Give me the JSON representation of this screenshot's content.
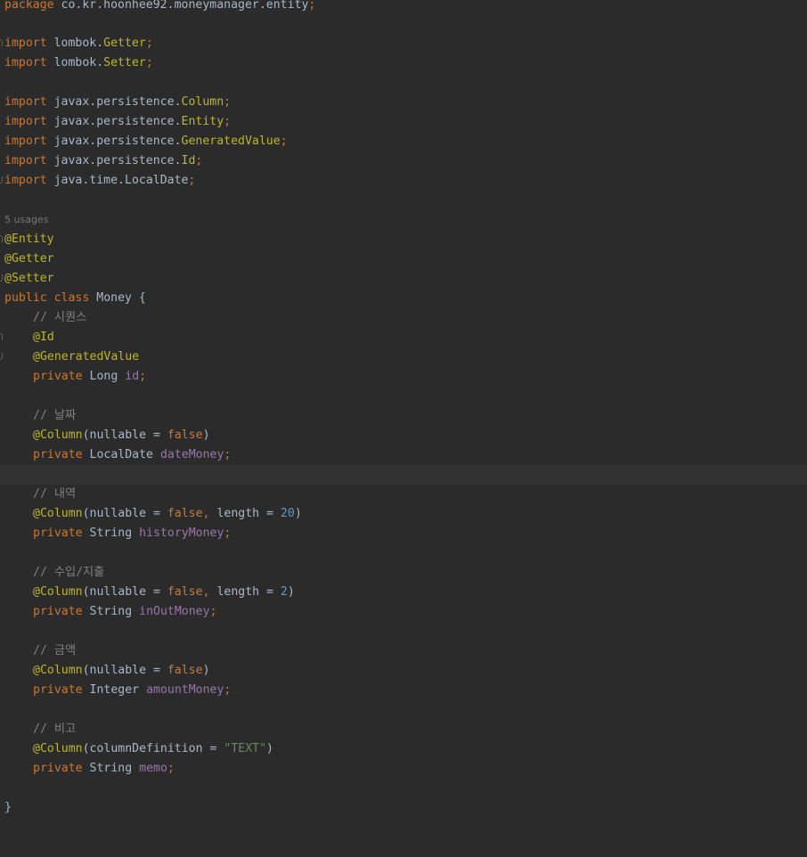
{
  "editor": {
    "package_line": {
      "keyword": "package",
      "name": "co.kr.hoonhee92.moneymanager.entity",
      "semicolon": ";"
    },
    "imports": [
      {
        "keyword": "import",
        "prefix": "lombok.",
        "cls": "Getter",
        "semicolon": ";"
      },
      {
        "keyword": "import",
        "prefix": "lombok.",
        "cls": "Setter",
        "semicolon": ";"
      },
      {
        "keyword": "import",
        "prefix": "javax.persistence.",
        "cls": "Column",
        "semicolon": ";"
      },
      {
        "keyword": "import",
        "prefix": "javax.persistence.",
        "cls": "Entity",
        "semicolon": ";"
      },
      {
        "keyword": "import",
        "prefix": "javax.persistence.",
        "cls": "GeneratedValue",
        "semicolon": ";"
      },
      {
        "keyword": "import",
        "prefix": "javax.persistence.",
        "cls": "Id",
        "semicolon": ";"
      },
      {
        "keyword": "import",
        "prefix": "java.time.",
        "cls": "LocalDate",
        "semicolon": ";"
      }
    ],
    "usages_hint": "5 usages",
    "class_annotations": [
      "@Entity",
      "@Getter",
      "@Setter"
    ],
    "class_decl": {
      "public": "public",
      "class_kw": "class",
      "name": "Money",
      "open_brace": "{"
    },
    "fields": {
      "id": {
        "comment": "// 시퀀스",
        "ann1": "@Id",
        "ann2": "@GeneratedValue",
        "modifier": "private",
        "type": "Long",
        "name": "id",
        "semicolon": ";"
      },
      "date": {
        "comment": "// 날짜",
        "ann": "@Column",
        "args_open": "(nullable = ",
        "val": "false",
        "args_close": ")",
        "modifier": "private",
        "type": "LocalDate",
        "name": "dateMoney",
        "semicolon": ";"
      },
      "history": {
        "comment": "// 내역",
        "ann": "@Column",
        "args_open": "(nullable = ",
        "val": "false",
        "comma": ",",
        "arg2": " length = ",
        "num": "20",
        "args_close": ")",
        "modifier": "private",
        "type": "String",
        "name": "historyMoney",
        "semicolon": ";"
      },
      "inout": {
        "comment": "// 수입/지출",
        "ann": "@Column",
        "args_open": "(nullable = ",
        "val": "false",
        "comma": ",",
        "arg2": " length = ",
        "num": "2",
        "args_close": ")",
        "modifier": "private",
        "type": "String",
        "name": "inOutMoney",
        "semicolon": ";"
      },
      "amount": {
        "comment": "// 금액",
        "ann": "@Column",
        "args_open": "(nullable = ",
        "val": "false",
        "args_close": ")",
        "modifier": "private",
        "type": "Integer",
        "name": "amountMoney",
        "semicolon": ";"
      },
      "memo": {
        "comment": "// 비고",
        "ann": "@Column",
        "args_open": "(columnDefinition = ",
        "str": "\"TEXT\"",
        "args_close": ")",
        "modifier": "private",
        "type": "String",
        "name": "memo",
        "semicolon": ";"
      }
    },
    "close_brace": "}"
  },
  "colors": {
    "background": "#2b2b2b",
    "current_line": "#323232",
    "keyword": "#cc7832",
    "annotation": "#bbb529",
    "field": "#9876aa",
    "number": "#6897bb",
    "string": "#6a8759",
    "comment": "#808080",
    "default": "#a9b7c6"
  }
}
